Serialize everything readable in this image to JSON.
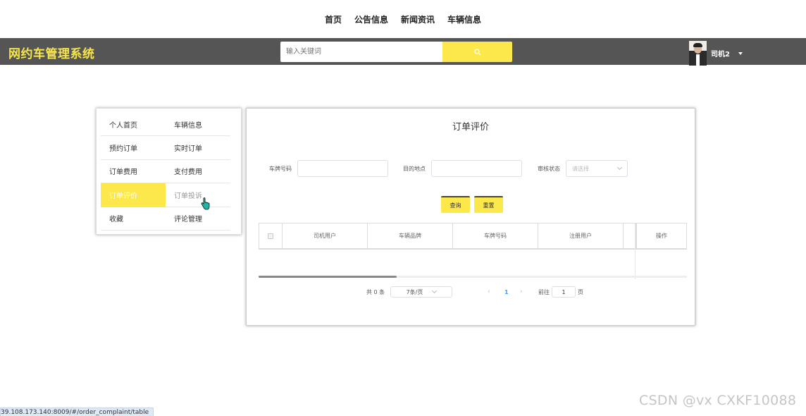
{
  "top_nav": [
    "首页",
    "公告信息",
    "新闻资讯",
    "车辆信息"
  ],
  "header": {
    "logo": "网约车管理系统",
    "search_placeholder": "输入关键词",
    "search_icon": "search-icon",
    "user_name": "司机2"
  },
  "sidebar": {
    "items": [
      {
        "label": "个人首页"
      },
      {
        "label": "车辆信息"
      },
      {
        "label": "预约订单"
      },
      {
        "label": "实时订单"
      },
      {
        "label": "订单费用"
      },
      {
        "label": "支付费用"
      },
      {
        "label": "订单评价",
        "active": true
      },
      {
        "label": "订单投诉"
      },
      {
        "label": "收藏"
      },
      {
        "label": "评论管理"
      }
    ]
  },
  "panel": {
    "title": "订单评价",
    "filters": {
      "plate_label": "车牌号码",
      "destination_label": "目的地点",
      "status_label": "审核状态",
      "status_placeholder": "请选择"
    },
    "buttons": {
      "query": "查询",
      "reset": "重置"
    },
    "table_headers": [
      "司机用户",
      "车辆品牌",
      "车牌号码",
      "注册用户",
      "操作"
    ],
    "pagination": {
      "total": "共 0 条",
      "page_size": "7条/页",
      "prev": "‹",
      "current_page": "1",
      "next": "›",
      "goto_label": "前往",
      "goto_value": "1",
      "page_suffix": "页"
    }
  },
  "status_url": "39.108.173.140:8009/#/order_complaint/table",
  "watermark": "CSDN @vx  CXKF10088",
  "colors": {
    "accent": "#fde84c",
    "header_bg": "#555555",
    "logo": "#f7e64b",
    "link_blue": "#409eff"
  }
}
